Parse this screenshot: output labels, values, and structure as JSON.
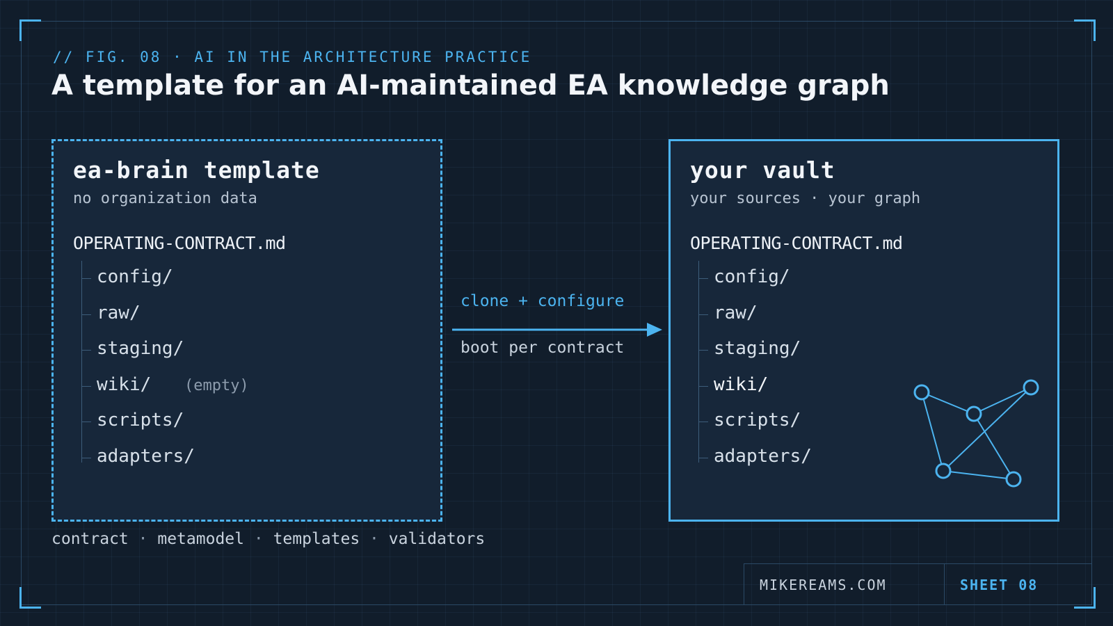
{
  "header": {
    "fig_label": "// FIG. 08 · AI IN THE ARCHITECTURE PRACTICE",
    "title": "A template for an AI-maintained EA knowledge graph"
  },
  "template_panel": {
    "title": "ea-brain template",
    "subtitle": "no organization data",
    "contract_file": "OPERATING-CONTRACT.md",
    "dirs": [
      "config/",
      "raw/",
      "staging/",
      "wiki/",
      "scripts/",
      "adapters/"
    ],
    "wiki_note": "(empty)"
  },
  "flow": {
    "action_label": "clone + configure",
    "result_label": "boot per contract"
  },
  "vault_panel": {
    "title": "your vault",
    "subtitle": "your sources · your graph",
    "contract_file": "OPERATING-CONTRACT.md",
    "dirs": [
      "config/",
      "raw/",
      "staging/",
      "wiki/",
      "scripts/",
      "adapters/"
    ]
  },
  "footer": {
    "tags": [
      "contract",
      "metamodel",
      "templates",
      "validators"
    ],
    "separator": "·",
    "site": "MIKEREAMS.COM",
    "sheet": "SHEET 08"
  },
  "colors": {
    "accent": "#4cb4f0",
    "background": "#111d2b",
    "panel": "#17273a"
  },
  "icons": {
    "arrow": "arrow-right-icon",
    "graph": "knowledge-graph-icon"
  }
}
